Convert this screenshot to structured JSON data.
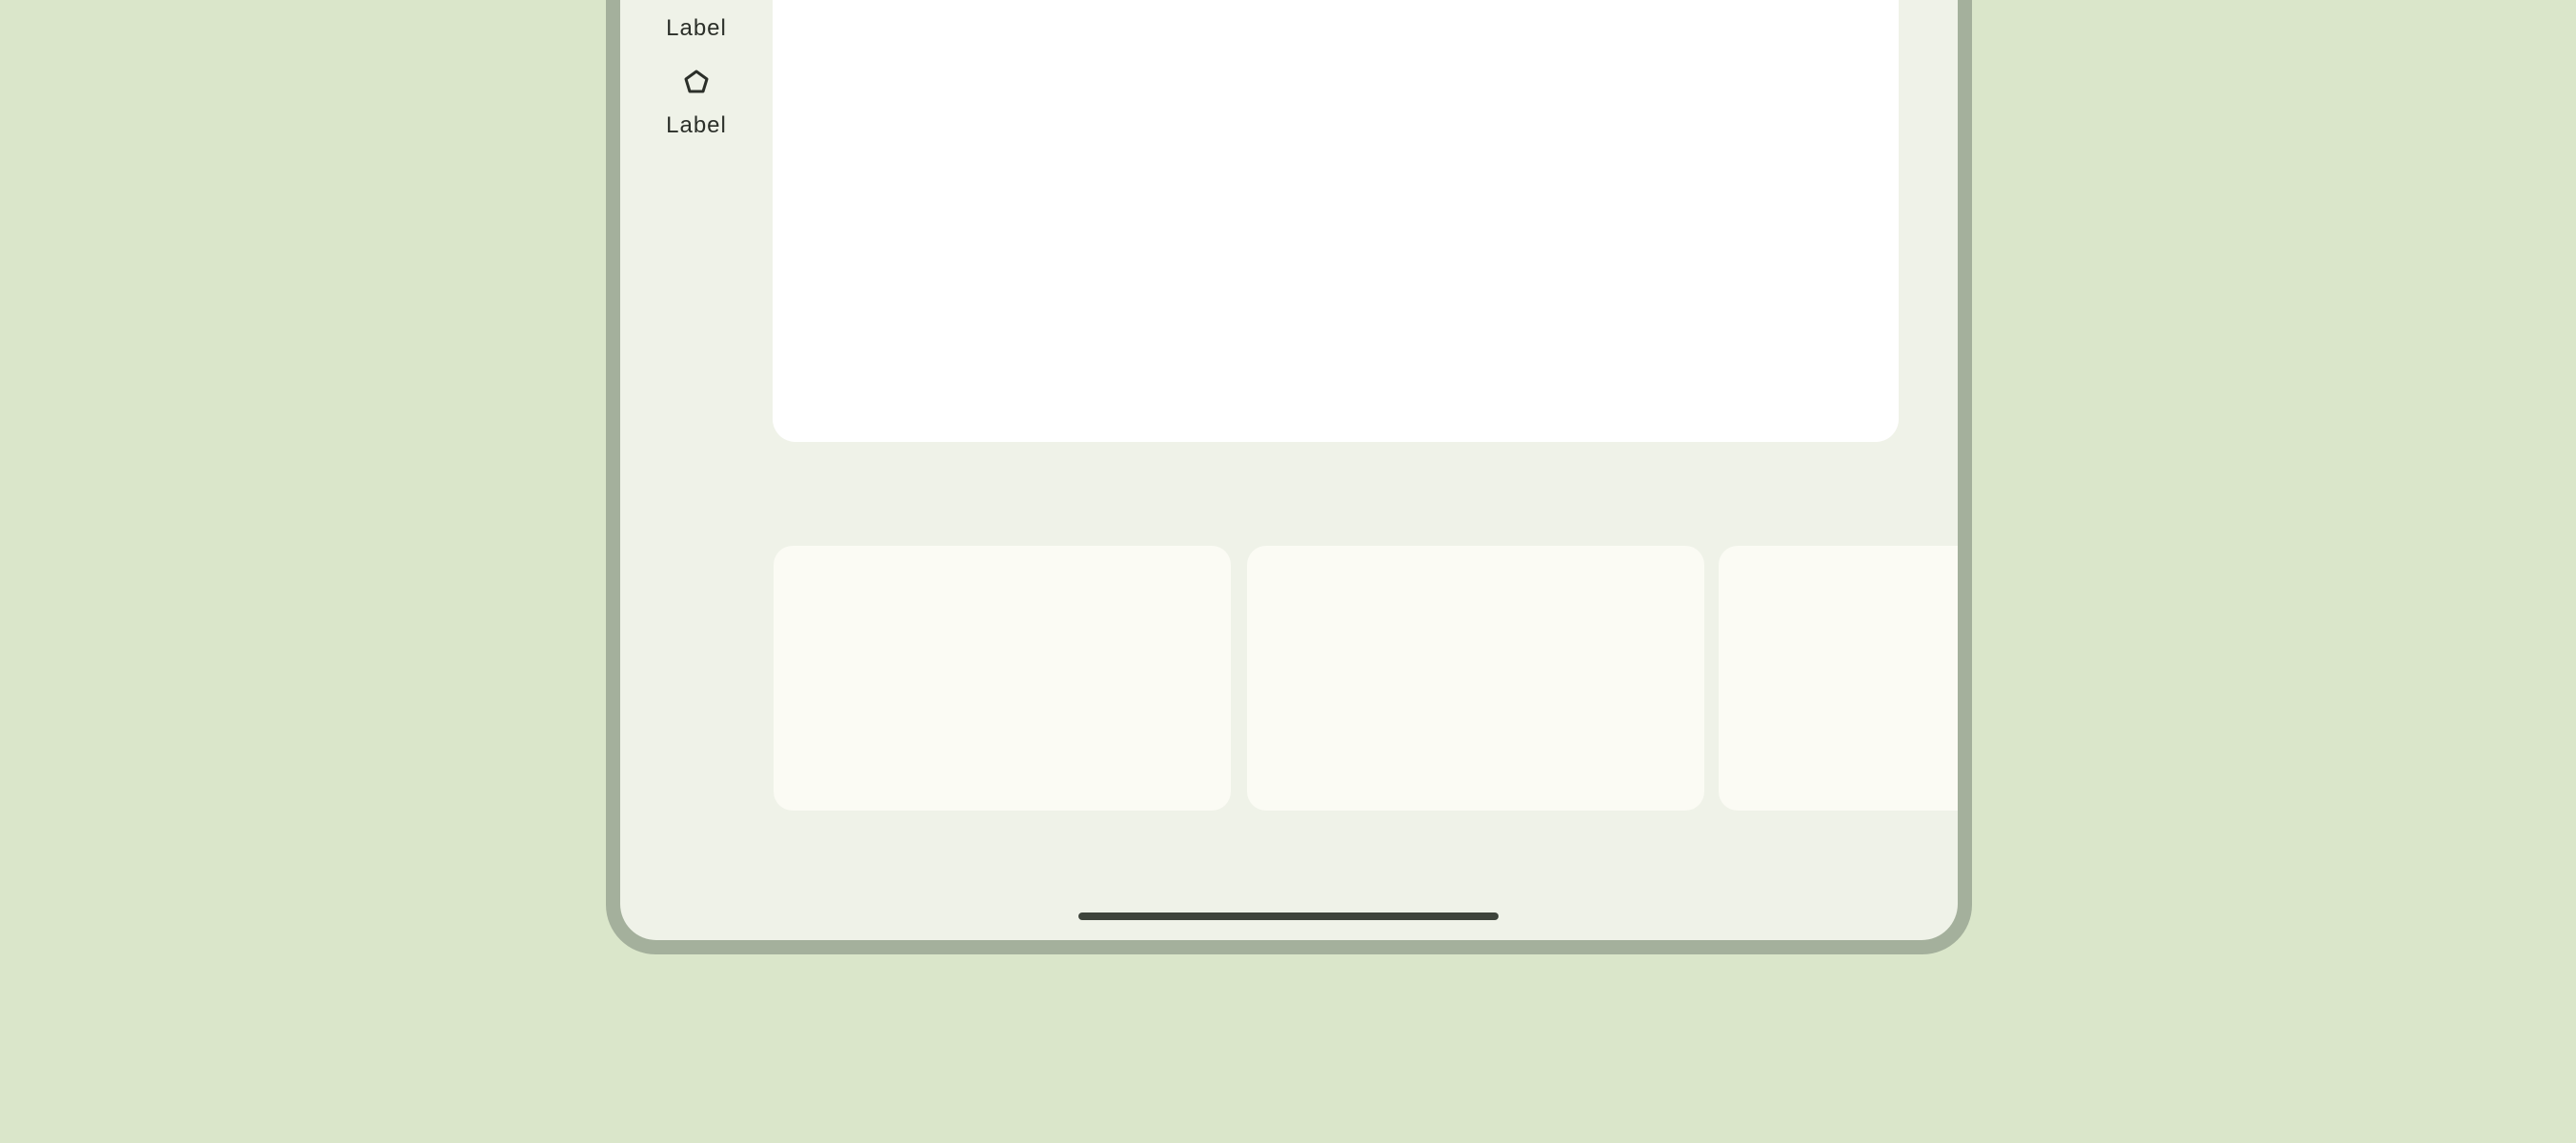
{
  "nav_rail": {
    "items": [
      {
        "label": "Label",
        "icon": "pentagon-icon"
      },
      {
        "label": "Label",
        "icon": "pentagon-icon"
      }
    ]
  },
  "main_content": {
    "card_count": 3
  },
  "colors": {
    "background": "#dae6ca",
    "device_frame": "#a4b09c",
    "screen_surface": "#eff2e8",
    "main_card": "#ffffff",
    "tile_surface": "#fbfbf4",
    "on_surface": "#2b2f29",
    "gesture_handle": "#3e443b"
  }
}
